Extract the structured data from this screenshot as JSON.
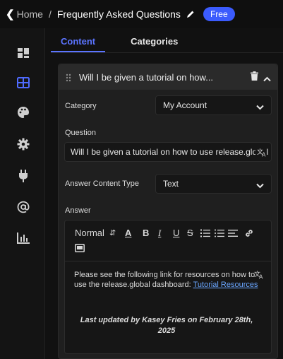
{
  "header": {
    "back_label": "Home",
    "separator": "/",
    "title": "Frequently Asked Questions",
    "badge": "Free"
  },
  "tabs": [
    {
      "label": "Content",
      "active": true
    },
    {
      "label": "Categories",
      "active": false
    }
  ],
  "faq_item": {
    "title": "Will I be given a tutorial on how...",
    "category_label": "Category",
    "category_value": "My Account",
    "question_label": "Question",
    "question_value": "Will I be given a tutorial on how to use release.global dashboard?",
    "answer_type_label": "Answer Content Type",
    "answer_type_value": "Text",
    "answer_label": "Answer",
    "editor": {
      "format_value": "Normal",
      "toolbar_buttons": [
        "A",
        "B",
        "I",
        "U",
        "S"
      ],
      "text_before_link": "Please see the following link for resources on how to use the release.global dashboard: ",
      "link_text": "Tutorial Resources",
      "updated_line": "Last updated by Kasey Fries on February 28th, 2025"
    }
  },
  "colors": {
    "accent": "#5b74ff",
    "badge": "#3b5bfd",
    "link": "#6aa6ff",
    "active_rail_icon": "#4f6bff"
  },
  "rail_icons": [
    "dashboard-icon",
    "table-icon",
    "palette-icon",
    "settings-gear-icon",
    "plug-icon",
    "at-sign-icon",
    "bar-chart-icon"
  ]
}
